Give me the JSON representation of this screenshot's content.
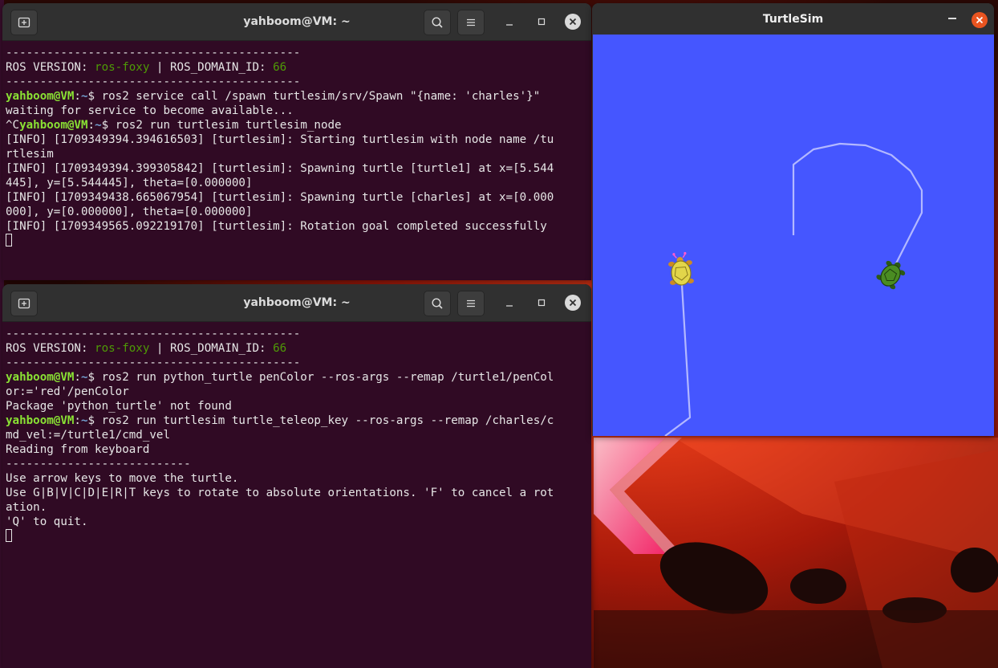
{
  "terminal_top": {
    "title": "yahboom@VM: ~",
    "lines": [
      [
        {
          "t": "-------------------------------------------",
          "c": ""
        }
      ],
      [
        {
          "t": "ROS VERSION: ",
          "c": ""
        },
        {
          "t": "ros-foxy",
          "c": "lgreen"
        },
        {
          "t": " | ROS_DOMAIN_ID: ",
          "c": ""
        },
        {
          "t": "66",
          "c": "lgreen"
        }
      ],
      [
        {
          "t": "-------------------------------------------",
          "c": ""
        }
      ],
      [
        {
          "t": "yahboom@VM",
          "c": "green"
        },
        {
          "t": ":",
          "c": ""
        },
        {
          "t": "~",
          "c": "blue"
        },
        {
          "t": "$ ros2 service call /spawn turtlesim/srv/Spawn \"{name: 'charles'}\"",
          "c": ""
        }
      ],
      [
        {
          "t": "waiting for service to become available...",
          "c": ""
        }
      ],
      [
        {
          "t": "^C",
          "c": ""
        },
        {
          "t": "yahboom@VM",
          "c": "green"
        },
        {
          "t": ":",
          "c": ""
        },
        {
          "t": "~",
          "c": "blue"
        },
        {
          "t": "$ ros2 run turtlesim turtlesim_node",
          "c": ""
        }
      ],
      [
        {
          "t": "[INFO] [1709349394.394616503] [turtlesim]: Starting turtlesim with node name /tu",
          "c": ""
        }
      ],
      [
        {
          "t": "rtlesim",
          "c": ""
        }
      ],
      [
        {
          "t": "[INFO] [1709349394.399305842] [turtlesim]: Spawning turtle [turtle1] at x=[5.544",
          "c": ""
        }
      ],
      [
        {
          "t": "445], y=[5.544445], theta=[0.000000]",
          "c": ""
        }
      ],
      [
        {
          "t": "[INFO] [1709349438.665067954] [turtlesim]: Spawning turtle [charles] at x=[0.000",
          "c": ""
        }
      ],
      [
        {
          "t": "000], y=[0.000000], theta=[0.000000]",
          "c": ""
        }
      ],
      [
        {
          "t": "[INFO] [1709349565.092219170] [turtlesim]: Rotation goal completed successfully",
          "c": ""
        }
      ]
    ]
  },
  "terminal_bottom": {
    "title": "yahboom@VM: ~",
    "lines": [
      [
        {
          "t": "-------------------------------------------",
          "c": ""
        }
      ],
      [
        {
          "t": "ROS VERSION: ",
          "c": ""
        },
        {
          "t": "ros-foxy",
          "c": "lgreen"
        },
        {
          "t": " | ROS_DOMAIN_ID: ",
          "c": ""
        },
        {
          "t": "66",
          "c": "lgreen"
        }
      ],
      [
        {
          "t": "-------------------------------------------",
          "c": ""
        }
      ],
      [
        {
          "t": "yahboom@VM",
          "c": "green"
        },
        {
          "t": ":",
          "c": ""
        },
        {
          "t": "~",
          "c": "blue"
        },
        {
          "t": "$ ros2 run python_turtle penColor --ros-args --remap /turtle1/penCol",
          "c": ""
        }
      ],
      [
        {
          "t": "or:='red'/penColor",
          "c": ""
        }
      ],
      [
        {
          "t": "Package 'python_turtle' not found",
          "c": ""
        }
      ],
      [
        {
          "t": "yahboom@VM",
          "c": "green"
        },
        {
          "t": ":",
          "c": ""
        },
        {
          "t": "~",
          "c": "blue"
        },
        {
          "t": "$ ros2 run turtlesim turtle_teleop_key --ros-args --remap /charles/c",
          "c": ""
        }
      ],
      [
        {
          "t": "md_vel:=/turtle1/cmd_vel",
          "c": ""
        }
      ],
      [
        {
          "t": "Reading from keyboard",
          "c": ""
        }
      ],
      [
        {
          "t": "---------------------------",
          "c": ""
        }
      ],
      [
        {
          "t": "Use arrow keys to move the turtle.",
          "c": ""
        }
      ],
      [
        {
          "t": "Use G|B|V|C|D|E|R|T keys to rotate to absolute orientations. 'F' to cancel a rot",
          "c": ""
        }
      ],
      [
        {
          "t": "ation.",
          "c": ""
        }
      ],
      [
        {
          "t": "'Q' to quit.",
          "c": ""
        }
      ]
    ]
  },
  "turtlesim": {
    "title": "TurtleSim",
    "background_color": "#4556ff",
    "path_color": "#b3b8ff"
  },
  "icons": {
    "new_tab": "new-tab-icon",
    "search": "search-icon",
    "menu": "hamburger-menu-icon",
    "minimize": "minimize-icon",
    "maximize": "maximize-icon",
    "close": "close-icon"
  }
}
